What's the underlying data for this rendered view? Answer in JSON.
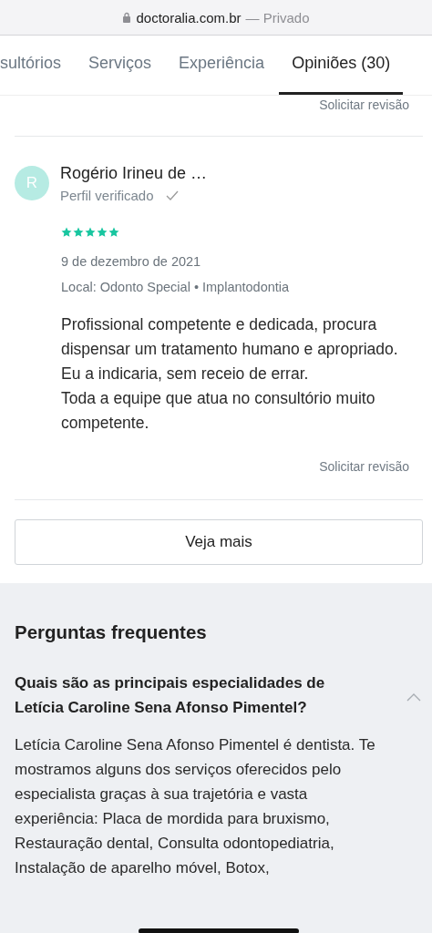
{
  "address_bar": {
    "domain": "doctoralia.com.br",
    "suffix": "— Privado"
  },
  "tabs": [
    {
      "label": "sultórios",
      "selected": false
    },
    {
      "label": "Serviços",
      "selected": false
    },
    {
      "label": "Experiência",
      "selected": false
    },
    {
      "label": "Opiniões (30)",
      "selected": true
    }
  ],
  "top_link": "Solicitar revisão",
  "review": {
    "avatar": "R",
    "name": "Rogério Irineu de …",
    "verified": "Perfil verificado",
    "stars": 5,
    "date": "9 de dezembro de 2021",
    "location": "Local: Odonto Special • Implantodontia",
    "body": "Profissional competente e dedicada, procura dispensar um tratamento humano e apropriado.\nEu a indicaria, sem receio de errar.\nToda a equipe que atua no consultório muito competente.",
    "link": "Solicitar revisão"
  },
  "more_button": "Veja mais",
  "faq": {
    "title": "Perguntas frequentes",
    "question": "Quais são as principais especialidades de Letícia Caroline Sena Afonso Pimentel?",
    "expanded": true,
    "answer": "Letícia Caroline Sena Afonso Pimentel é dentista. Te\nmostramos alguns dos serviços oferecidos pelo\nespecialista graças à sua trajetória e vasta\nexperiência: Placa de mordida para bruxismo,\nRestauração dental, Consulta odontopediatria,\nInstalação de aparelho móvel, Botox,"
  }
}
